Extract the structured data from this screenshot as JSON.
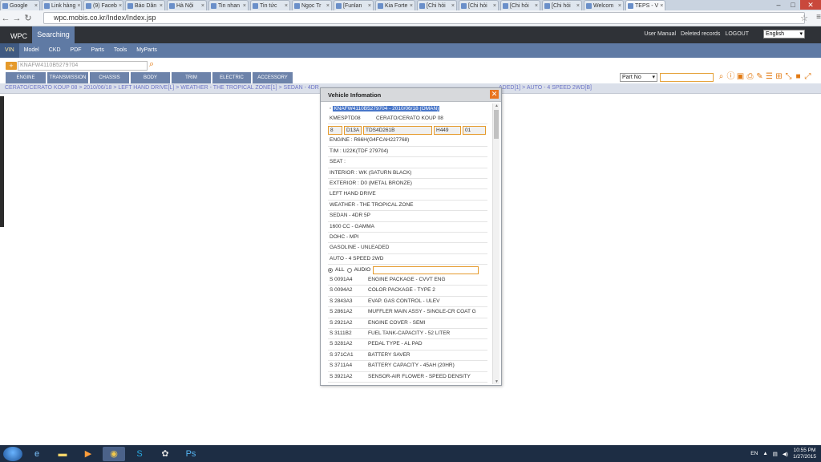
{
  "browser": {
    "tabs": [
      {
        "label": "Google"
      },
      {
        "label": "Link hàng"
      },
      {
        "label": "(9) Faceb"
      },
      {
        "label": "Báo Dân"
      },
      {
        "label": "Hà Nội"
      },
      {
        "label": "Tin nhan"
      },
      {
        "label": "Tin tức"
      },
      {
        "label": "Ngọc Tr"
      },
      {
        "label": "[Funlan"
      },
      {
        "label": "Kia Forte"
      },
      {
        "label": "[Chi hỏi"
      },
      {
        "label": "[Chi hỏi"
      },
      {
        "label": "[Chi hỏi"
      },
      {
        "label": "[Chi hỏi"
      },
      {
        "label": "Welcom"
      },
      {
        "label": "TEPS - V"
      }
    ],
    "url": "wpc.mobis.co.kr/Index/Index.jsp"
  },
  "app": {
    "brand_tab": "WPC",
    "active_tab": "Searching",
    "header_links": [
      "User Manual",
      "Deleted records",
      "LOGOUT"
    ],
    "language": "English",
    "subnav": [
      "VIN",
      "Model",
      "CKD",
      "PDF",
      "Parts",
      "Tools",
      "MyParts"
    ],
    "vin_value": "KNAFW4110B5279704",
    "categories": [
      "ENGINE",
      "TRANSMISSION",
      "CHASSIS",
      "BODY",
      "TRIM",
      "ELECTRIC",
      "ACCESSORY"
    ],
    "part_search_mode": "Part No",
    "breadcrumb_left": "CERATO/CERATO KOUP 08  >  2010/06/18  >  LEFT HAND DRIVE[L]  >  WEATHER - THE TROPICAL ZONE[1]  >  SEDAN - 4DR",
    "breadcrumb_right": "ADED[1]  >  AUTO - 4 SPEED 2WD[B]"
  },
  "modal": {
    "title": "Vehicle Infomation",
    "vin_line": "KNAFW4110B5279704 - 2010/06/18 (OMAN)",
    "model_code": "KMESPTD08",
    "model_name": "CERATO/CERATO KOUP 08",
    "codes": [
      "8",
      "D13A",
      "TDS4D261B",
      "H449",
      "01"
    ],
    "spec_rows": [
      "ENGINE : R66H(G4FCAH227768)",
      "T/M : U22K(TDF 279704)",
      "SEAT :",
      "INTERIOR : WK (SATURN BLACK)",
      "EXTERIOR : D0 (METAL BRONZE)",
      "LEFT HAND DRIVE",
      "WEATHER - THE TROPICAL ZONE",
      "SEDAN - 4DR 5P",
      "1600 CC - GAMMA",
      "DOHC - MPI",
      "GASOLINE - UNLEADED",
      "AUTO - 4 SPEED 2WD"
    ],
    "radio_all": "ALL",
    "radio_audio": "AUDIO",
    "options": [
      {
        "code": "S 0091A4",
        "desc": "ENGINE PACKAGE - CVVT ENG"
      },
      {
        "code": "S 0094A2",
        "desc": "COLOR PACKAGE - TYPE 2"
      },
      {
        "code": "S 2843A3",
        "desc": "EVAP. GAS CONTROL - ULEV"
      },
      {
        "code": "S 2861A2",
        "desc": "MUFFLER MAIN ASSY - SINGLE-CR COAT G"
      },
      {
        "code": "S 2921A2",
        "desc": "ENGINE COVER - SEMI"
      },
      {
        "code": "S 3111B2",
        "desc": "FUEL TANK-CAPACITY - 52 LITER"
      },
      {
        "code": "S 3281A2",
        "desc": "PEDAL TYPE - AL PAD"
      },
      {
        "code": "S 371CA1",
        "desc": "BATTERY SAVER"
      },
      {
        "code": "S 3711A4",
        "desc": "BATTERY CAPACITY - 45AH (20HR)"
      },
      {
        "code": "S 3921A2",
        "desc": "SENSOR-AIR FLOWER - SPEED DENSITY"
      }
    ]
  },
  "taskbar": {
    "lang": "EN",
    "time": "10:55 PM",
    "date": "1/27/2015"
  }
}
